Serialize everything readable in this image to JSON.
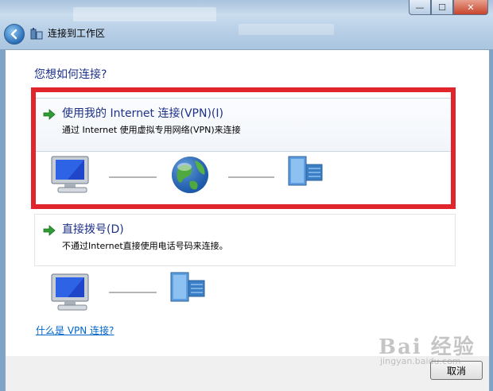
{
  "window": {
    "title": "连接到工作区",
    "controls": {
      "minimize": "—",
      "maximize": "☐",
      "close": "✕"
    }
  },
  "question": "您想如何连接?",
  "options": [
    {
      "title": "使用我的 Internet 连接(VPN)(I)",
      "description": "通过 Internet 使用虚拟专用网络(VPN)来连接",
      "icon": "green-arrow-icon",
      "diagram": [
        "computer-icon",
        "globe-icon",
        "server-icon"
      ]
    },
    {
      "title": "直接拨号(D)",
      "description": "不通过Internet直接使用电话号码来连接。",
      "icon": "green-arrow-icon",
      "diagram": [
        "computer-icon",
        "server-icon"
      ]
    }
  ],
  "help_link": "什么是 VPN 连接?",
  "footer": {
    "cancel_label": "取消"
  },
  "watermark": {
    "text": "Bai 经验",
    "sub": "jingyan.baidu.com"
  },
  "colors": {
    "highlight_frame": "#e0262c",
    "heading": "#1e3287",
    "link": "#0066cc"
  }
}
